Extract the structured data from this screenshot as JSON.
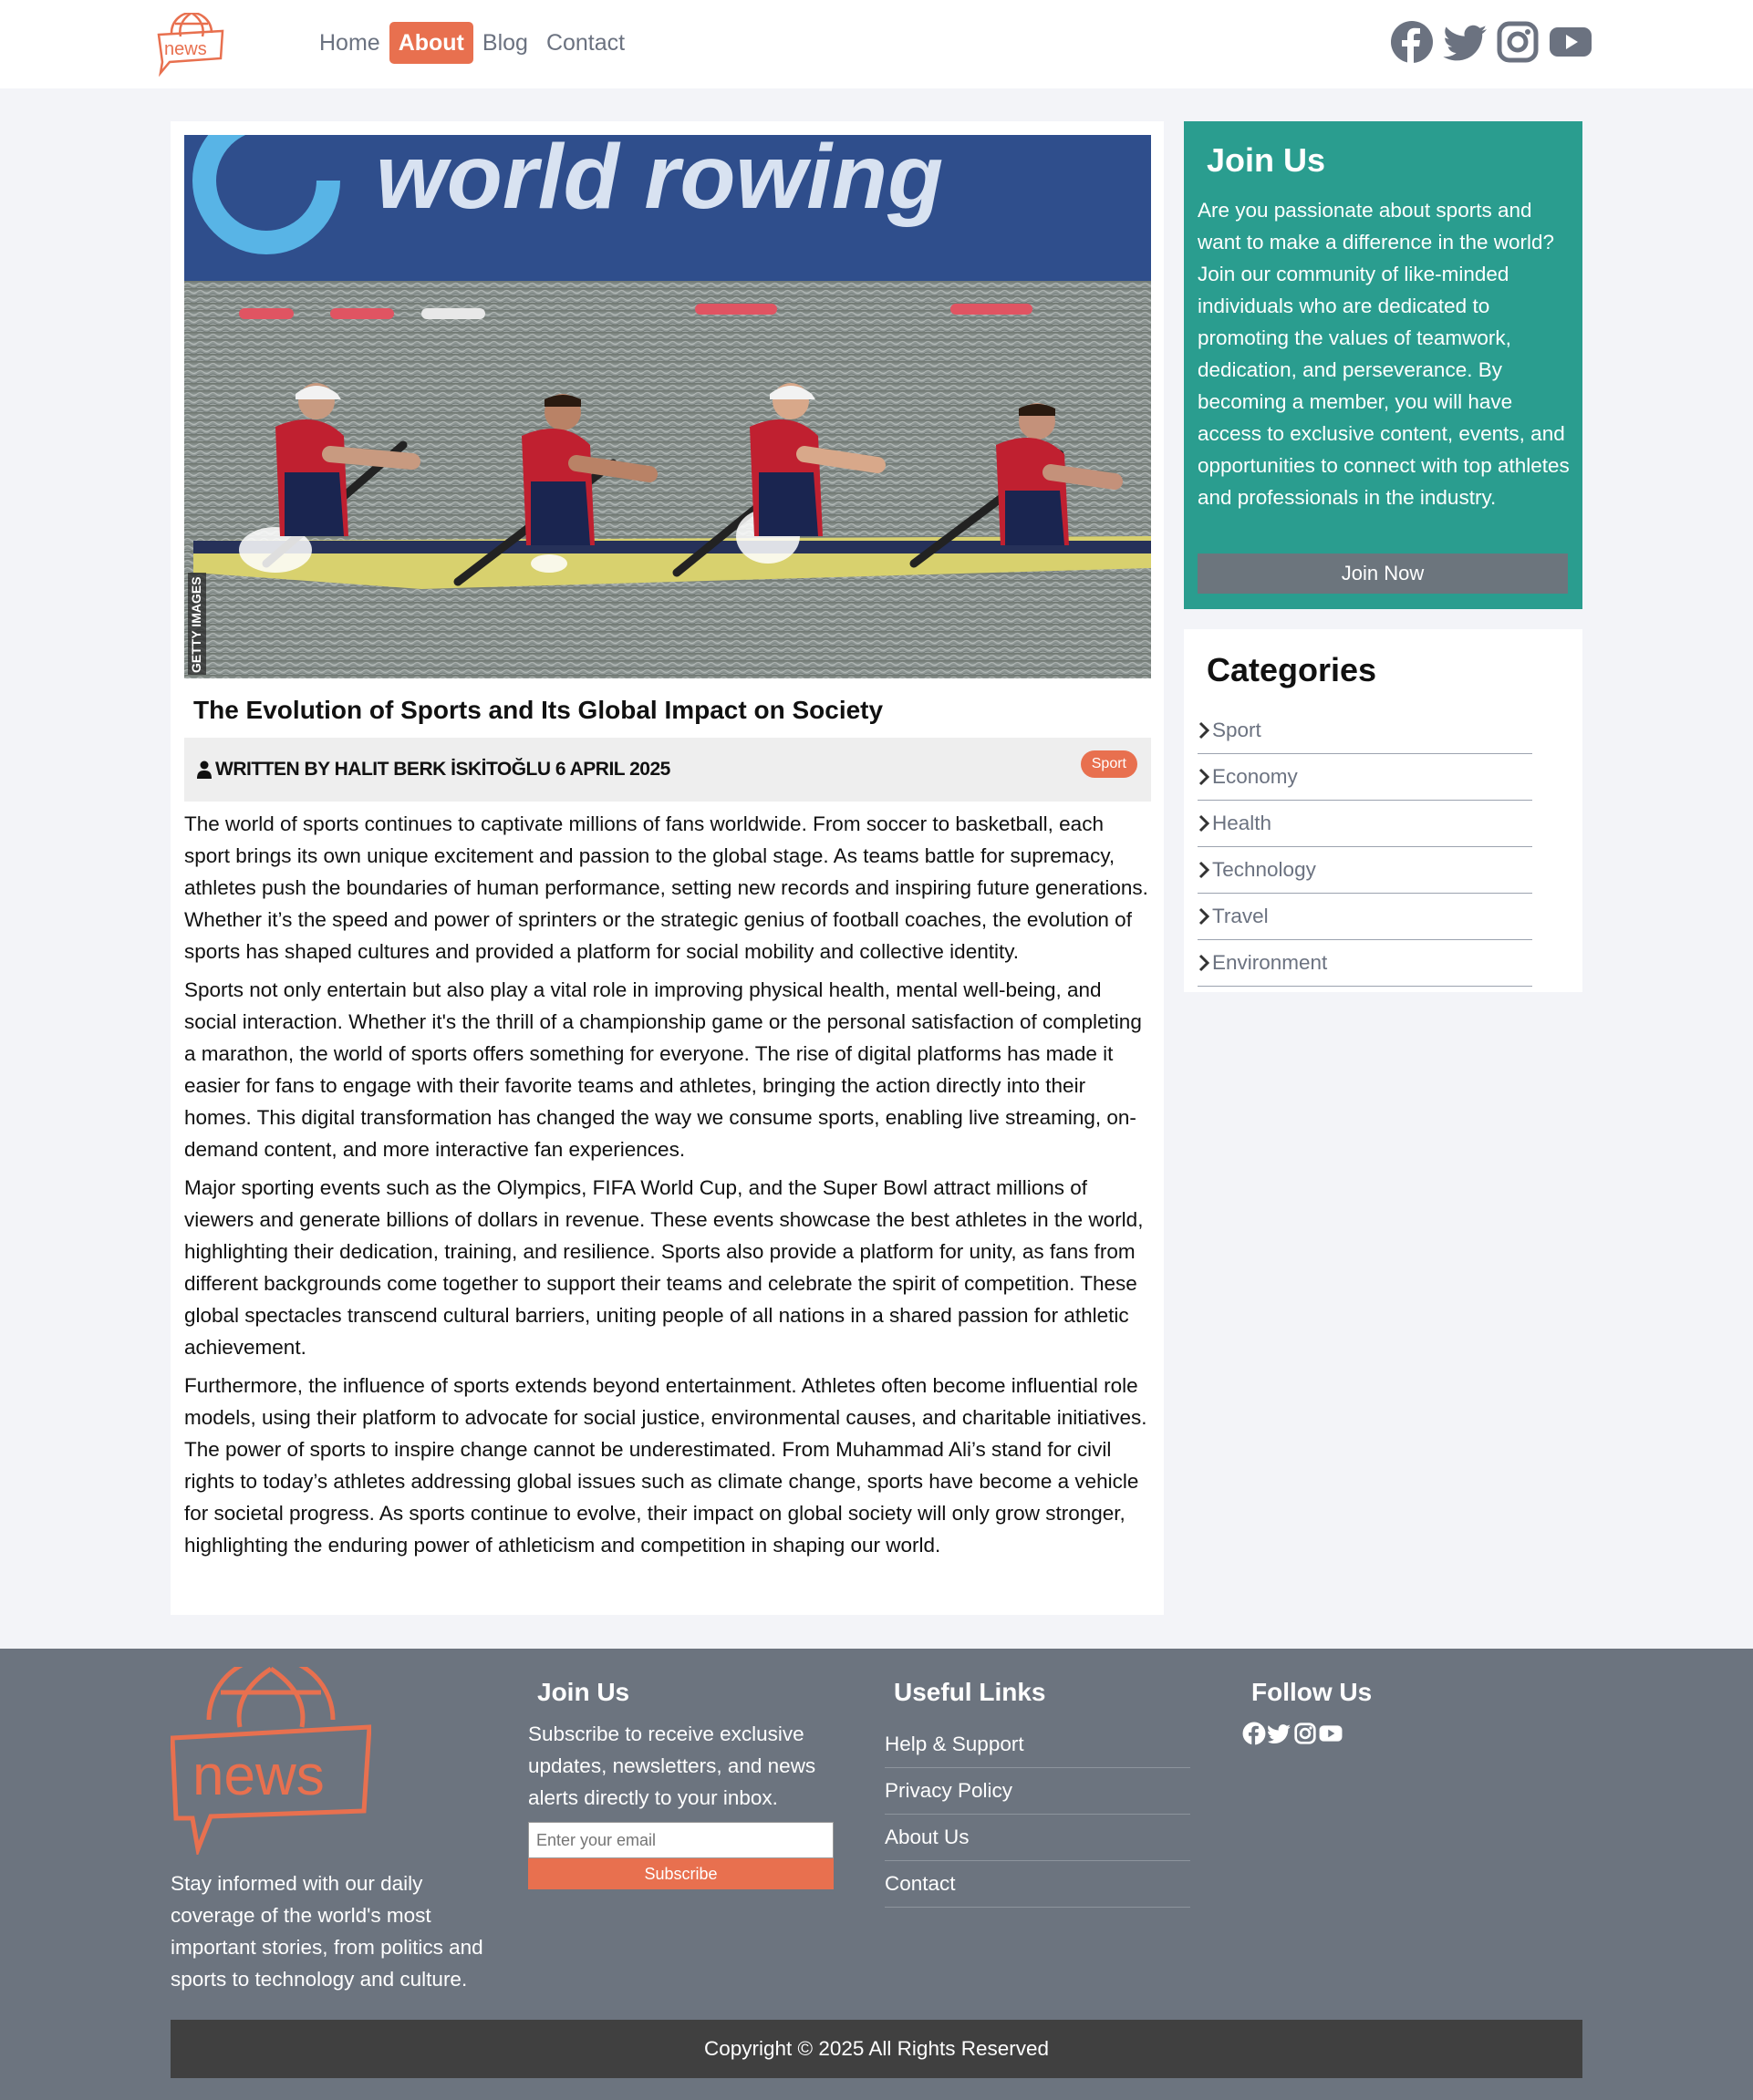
{
  "header": {
    "logo_text": "news",
    "nav": [
      "Home",
      "About",
      "Blog",
      "Contact"
    ],
    "active_nav": "About",
    "social_icons": [
      "facebook-icon",
      "twitter-icon",
      "instagram-icon",
      "youtube-icon"
    ]
  },
  "article": {
    "hero_banner_text": "world rowing",
    "hero_watermark": "GETTY IMAGES",
    "title": "The Evolution of Sports and Its Global Impact on Society",
    "byline": "WRITTEN BY HALIT BERK İSKİTOĞLU 6 APRIL 2025",
    "category_badge": "Sport",
    "paragraphs": [
      "The world of sports continues to captivate millions of fans worldwide. From soccer to basketball, each sport brings its own unique excitement and passion to the global stage. As teams battle for supremacy, athletes push the boundaries of human performance, setting new records and inspiring future generations. Whether it’s the speed and power of sprinters or the strategic genius of football coaches, the evolution of sports has shaped cultures and provided a platform for social mobility and collective identity.",
      "Sports not only entertain but also play a vital role in improving physical health, mental well-being, and social interaction. Whether it's the thrill of a championship game or the personal satisfaction of completing a marathon, the world of sports offers something for everyone. The rise of digital platforms has made it easier for fans to engage with their favorite teams and athletes, bringing the action directly into their homes. This digital transformation has changed the way we consume sports, enabling live streaming, on-demand content, and more interactive fan experiences.",
      "Major sporting events such as the Olympics, FIFA World Cup, and the Super Bowl attract millions of viewers and generate billions of dollars in revenue. These events showcase the best athletes in the world, highlighting their dedication, training, and resilience. Sports also provide a platform for unity, as fans from different backgrounds come together to support their teams and celebrate the spirit of competition. These global spectacles transcend cultural barriers, uniting people of all nations in a shared passion for athletic achievement.",
      "Furthermore, the influence of sports extends beyond entertainment. Athletes often become influential role models, using their platform to advocate for social justice, environmental causes, and charitable initiatives. The power of sports to inspire change cannot be underestimated. From Muhammad Ali’s stand for civil rights to today’s athletes addressing global issues such as climate change, sports have become a vehicle for societal progress. As sports continue to evolve, their impact on global society will only grow stronger, highlighting the enduring power of athleticism and competition in shaping our world."
    ]
  },
  "sidebar": {
    "join": {
      "title": "Join Us",
      "text": "Are you passionate about sports and want to make a difference in the world? Join our community of like-minded individuals who are dedicated to promoting the values of teamwork, dedication, and perseverance. By becoming a member, you will have access to exclusive content, events, and opportunities to connect with top athletes and professionals in the industry.",
      "button": "Join Now"
    },
    "categories": {
      "title": "Categories",
      "items": [
        "Sport",
        "Economy",
        "Health",
        "Technology",
        "Travel",
        "Environment"
      ]
    }
  },
  "footer": {
    "about": "Stay informed with our daily coverage of the world's most important stories, from politics and sports to technology and culture.",
    "join": {
      "title": "Join Us",
      "text": "Subscribe to receive exclusive updates, newsletters, and news alerts directly to your inbox.",
      "email_placeholder": "Enter your email",
      "button": "Subscribe"
    },
    "links": {
      "title": "Useful Links",
      "items": [
        "Help & Support",
        "Privacy Policy",
        "About Us",
        "Contact"
      ]
    },
    "follow": {
      "title": "Follow Us"
    },
    "copyright": "Copyright © 2025 All Rights Reserved"
  },
  "colors": {
    "accent": "#e8704f",
    "teal": "#2a9d8f",
    "footer_bg": "#6c747f",
    "copyright_bg": "#404040"
  }
}
